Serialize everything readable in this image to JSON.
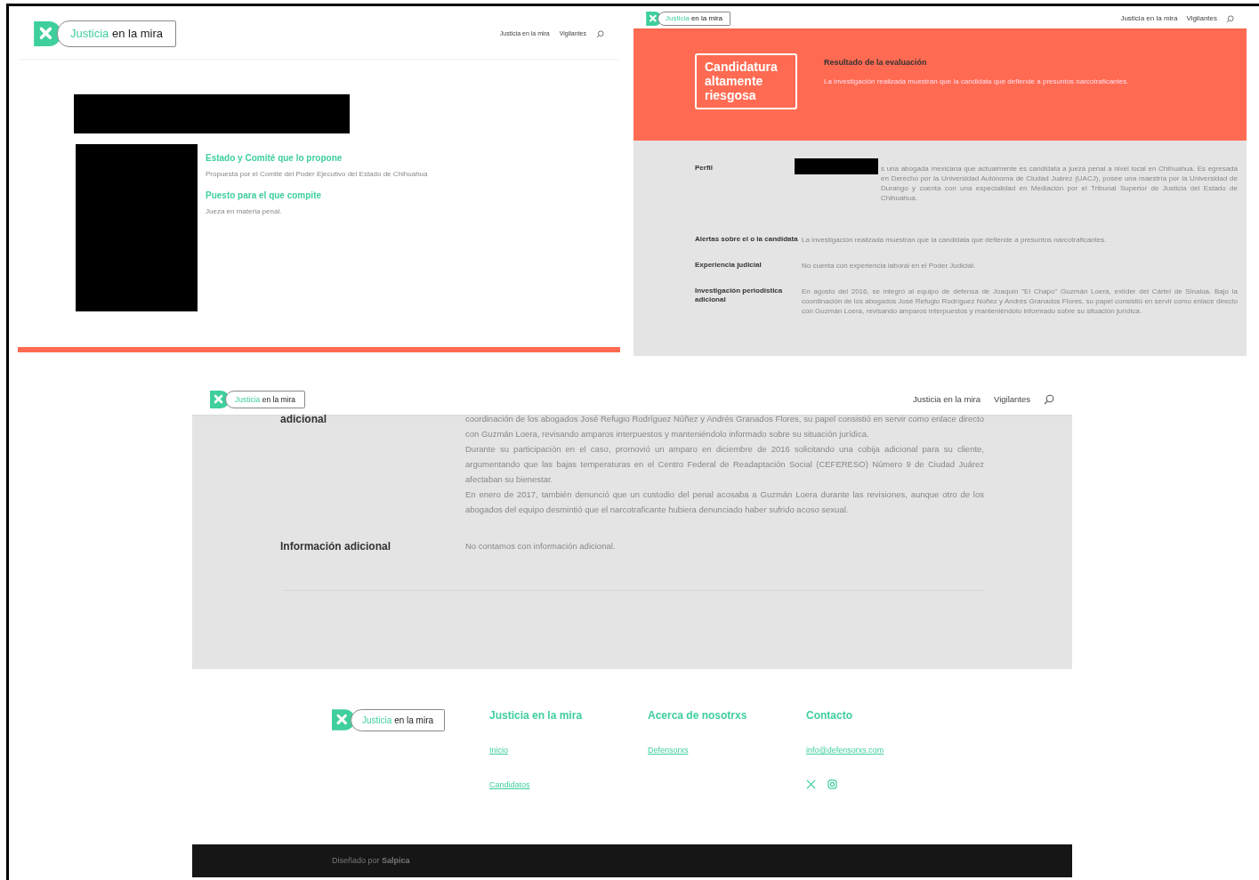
{
  "panels": [
    {
      "kind": "candidate",
      "header": {
        "logo": {
          "accent": "Justicia",
          "rest": "en la mira"
        },
        "nav_links": [
          "Justicia en la mira",
          "Vigilantes"
        ]
      },
      "facts": [
        {
          "heading": "Estado y Comité que lo propone",
          "text": "Propuesta por el Comité del Poder Ejecutivo del Estado de Chihuahua"
        },
        {
          "heading": "Puesto para el que compite",
          "text": "Jueza en materia penal."
        }
      ]
    },
    {
      "kind": "evaluation",
      "header": {
        "logo": {
          "accent": "Justicia",
          "rest": "en la mira"
        },
        "nav_links": [
          "Justicia en la mira",
          "Vigilantes"
        ]
      },
      "rating": "Candidatura altamente riesgosa",
      "result": {
        "title": "Resultado de la evaluación",
        "text": "La investigación realizada muestran que la candidata que defiende a presuntos narcotraficantes."
      },
      "rows": [
        {
          "label": "Perfil",
          "redacted_prefix": true,
          "paragraphs": [
            "s una abogada mexicana que actualmente es candidata a jueza penal a nivel local en Chihuahua. Es egresada en Derecho por la Universidad Autónoma de Ciudad Juárez (UACJ), posee una maestría por la Universidad de Durango y cuenta con una especialidad en Mediación por el Tribunal Superior de Justicia del Estado de Chihuahua."
          ]
        },
        {
          "label": "Alertas sobre el o la candidata",
          "redacted_prefix": false,
          "paragraphs": [
            "La investigación realizada muestran que la candidata que defiende a presuntos narcotraficantes."
          ]
        },
        {
          "label": "Experiencia judicial",
          "redacted_prefix": false,
          "paragraphs": [
            "No cuenta con experiencia laboral en el Poder Judicial."
          ]
        },
        {
          "label": "Investigación periodística adicional",
          "redacted_prefix": false,
          "paragraphs": [
            "En agosto del 2016, se integró al equipo de defensa de Joaquín \"El Chapo\" Guzmán Loera, exlíder del Cártel de Sinaloa. Bajo la coordinación de los abogados José Refugio Rodríguez Núñez y Andrés Granados Flores, su papel consistió en servir como enlace directo con Guzmán Loera, revisando amparos interpuestos y manteniéndolo informado sobre su situación jurídica."
          ]
        }
      ]
    },
    {
      "kind": "details",
      "header": {
        "logo": {
          "accent": "Justicia",
          "rest": "en la mira"
        },
        "nav_links": [
          "Justicia en la mira",
          "Vigilantes"
        ]
      },
      "rows": [
        {
          "label": "adicional",
          "redacted_prefix": false,
          "paragraphs": [
            "coordinación de los abogados José Refugio Rodríguez Núñez y Andrés Granados Flores, su papel consistió en servir como enlace directo con Guzmán Loera, revisando amparos interpuestos y manteniéndolo informado sobre su situación jurídica.",
            "Durante su participación en el caso, promovió un amparo en diciembre de 2016 solicitando una cobija adicional para su cliente, argumentando que las bajas temperaturas en el Centro Federal de Readaptación Social (CEFERESO) Número 9 de Ciudad Juárez afectaban su bienestar.",
            "En enero de 2017, también denunció que un custodio del penal acosaba a Guzmán Loera durante las revisiones, aunque otro de los abogados del equipo desmintió que el narcotraficante hubiera denunciado haber sufrido acoso sexual."
          ]
        },
        {
          "label": "Información adicional",
          "redacted_prefix": false,
          "paragraphs": [
            "No contamos con información adicional."
          ]
        }
      ],
      "footer": {
        "logo": {
          "accent": "Justicia",
          "rest": "en la mira"
        },
        "columns": [
          {
            "title": "Justicia en la mira",
            "links": [
              "Inicio",
              "Candidatos"
            ],
            "social": false
          },
          {
            "title": "Acerca de nosotrxs",
            "links": [
              "Defensorxs"
            ],
            "social": false
          },
          {
            "title": "Contacto",
            "links": [
              "info@defensorxs.com"
            ],
            "social": true
          }
        ],
        "credit": "Diseñado por **Salpica**"
      }
    }
  ]
}
